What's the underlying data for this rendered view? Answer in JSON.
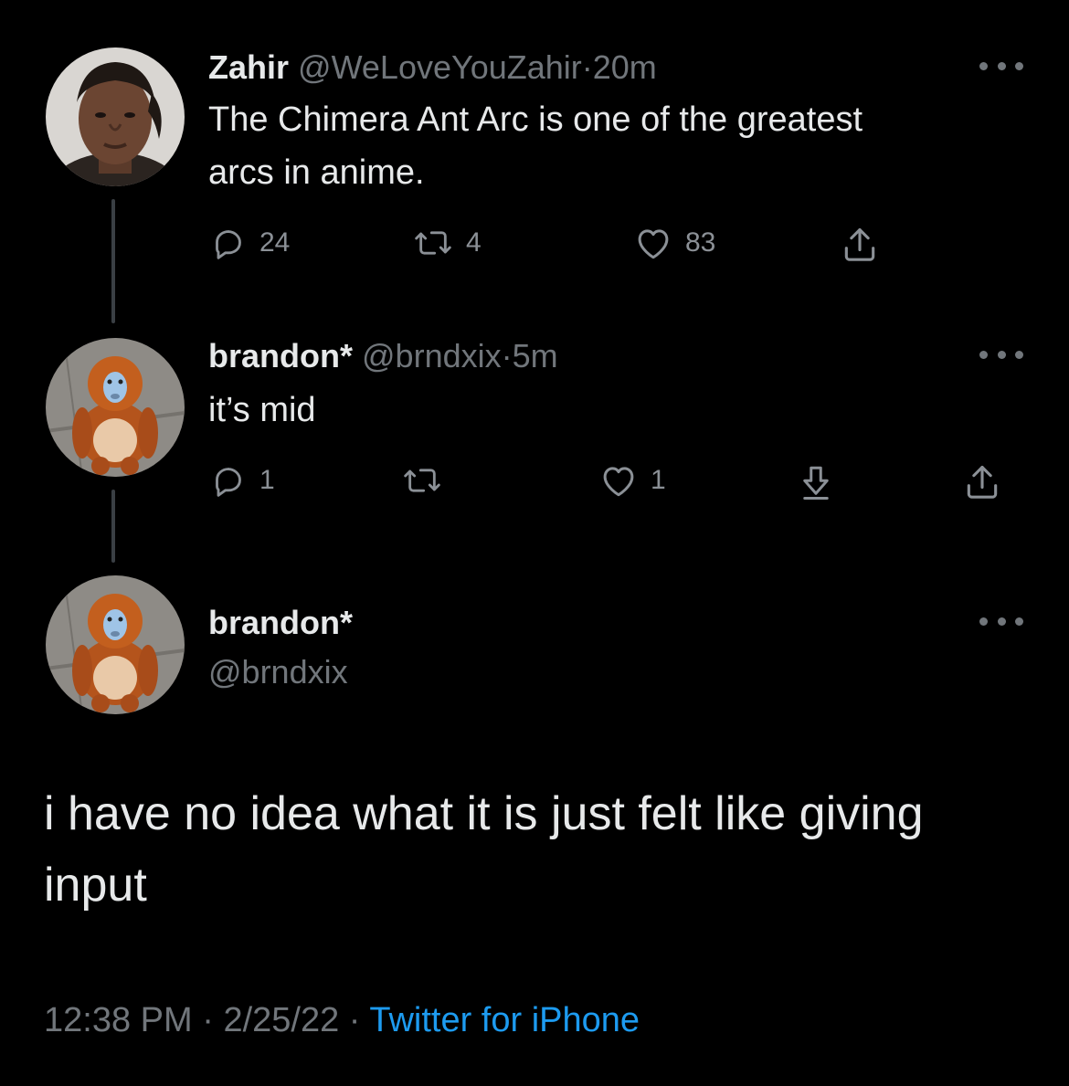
{
  "tweets": [
    {
      "name": "Zahir",
      "handle": "@WeLoveYouZahir",
      "separator": "·",
      "time": "20m",
      "text_line1": "The Chimera Ant Arc is one of the greatest",
      "text_line2": "arcs in anime.",
      "replies": "24",
      "retweets": "4",
      "likes": "83",
      "avatar_icon": "profile-photo-person"
    },
    {
      "name": "brandon*",
      "handle": "@brndxix",
      "separator": "·",
      "time": "5m",
      "text": "it’s mid",
      "replies": "1",
      "retweets": "",
      "likes": "1",
      "avatar_icon": "profile-photo-golden-monkey"
    }
  ],
  "main_tweet": {
    "name": "brandon*",
    "handle": "@brndxix",
    "text": "i have no idea what it is just felt like giving input",
    "time": "12:38 PM",
    "separator": "·",
    "date": "2/25/22",
    "source": "Twitter for iPhone",
    "avatar_icon": "profile-photo-golden-monkey"
  },
  "icons": {
    "reply": "reply-icon",
    "retweet": "retweet-icon",
    "like": "heart-icon",
    "share": "share-icon",
    "download": "download-icon",
    "more": "more-icon"
  },
  "colors": {
    "background": "#000000",
    "text": "#e7e9ea",
    "secondary": "#71767b",
    "link": "#1d9bf0"
  }
}
